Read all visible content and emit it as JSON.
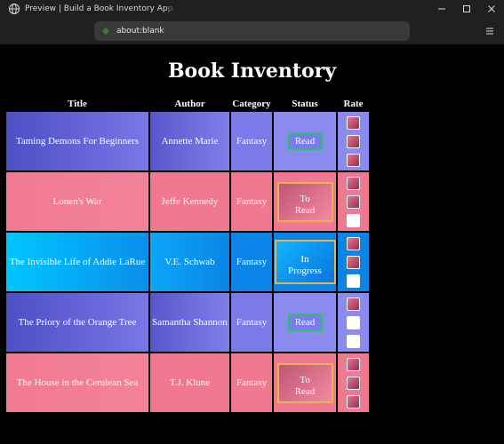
{
  "window": {
    "title": "Preview | Build a Book Inventory App",
    "title_visible": "Preview | Build a Book Inventory Ap",
    "title_faded": "p"
  },
  "browser": {
    "url": "about:blank"
  },
  "page": {
    "heading": "Book Inventory"
  },
  "table": {
    "headers": {
      "title": "Title",
      "author": "Author",
      "category": "Category",
      "status": "Status",
      "rate": "Rate"
    },
    "rows": [
      {
        "title": "Taming Demons For Beginners",
        "author": "Annette Marie",
        "category": "Fantasy",
        "status": "Read",
        "status_kind": "read",
        "rating": [
          true,
          true,
          true
        ]
      },
      {
        "title": "Lonen's War",
        "author": "Jeffe Kennedy",
        "category": "Fantasy",
        "status_line1": "To",
        "status_line2": "Read",
        "status_kind": "toread",
        "rating": [
          true,
          true,
          false
        ]
      },
      {
        "title": "The Invisible Life of Addie LaRue",
        "author": "V.E. Schwab",
        "category": "Fantasy",
        "status_line1": "In",
        "status_line2": "Progress",
        "status_kind": "inprog",
        "rating": [
          true,
          true,
          false
        ]
      },
      {
        "title": "The Priory of the Orange Tree",
        "author": "Samantha Shannon",
        "category": "Fantasy",
        "status": "Read",
        "status_kind": "read",
        "rating": [
          true,
          false,
          false
        ]
      },
      {
        "title": "The House in the Cerulean Sea",
        "author": "T.J. Klune",
        "category": "Fantasy",
        "status_line1": "To",
        "status_line2": "Read",
        "status_kind": "toread",
        "rating": [
          true,
          true,
          true
        ]
      }
    ]
  }
}
